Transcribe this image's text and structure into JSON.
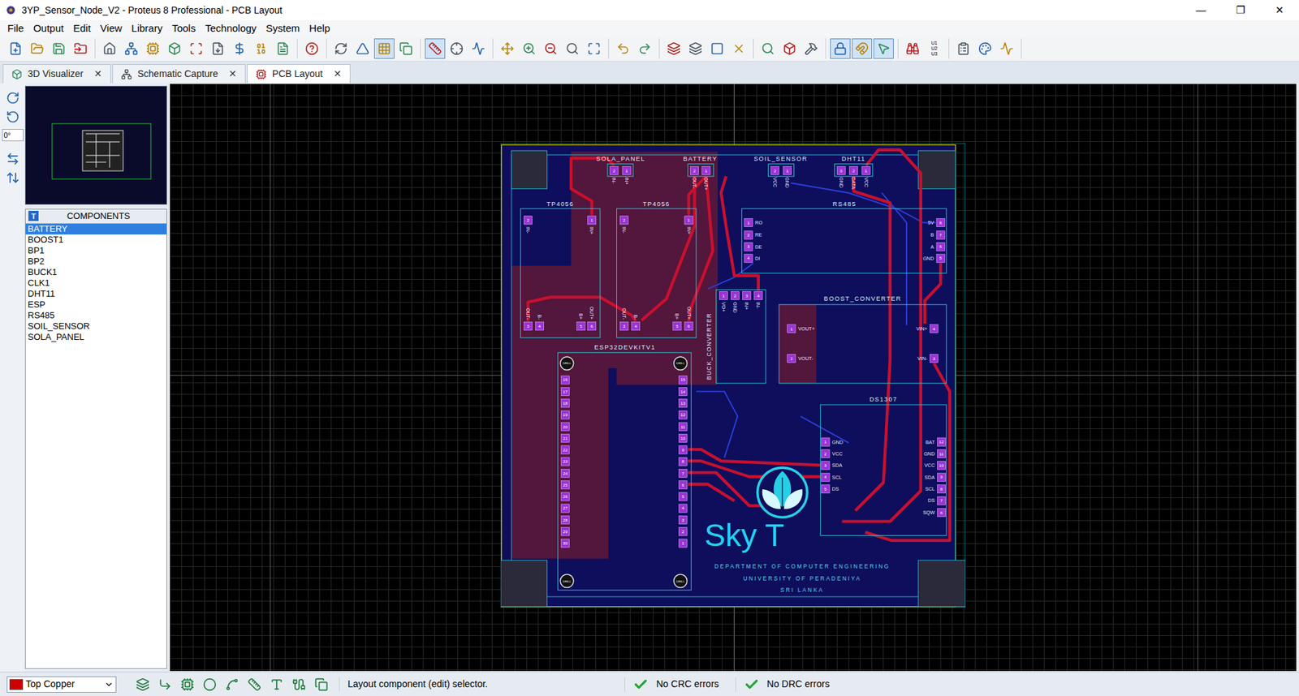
{
  "window": {
    "title": "3YP_Sensor_Node_V2 - Proteus 8 Professional - PCB Layout",
    "controls": [
      "—",
      "❐",
      "✕"
    ]
  },
  "menu": [
    "File",
    "Output",
    "Edit",
    "View",
    "Library",
    "Tools",
    "Technology",
    "System",
    "Help"
  ],
  "toolbar": {
    "groups": [
      [
        {
          "selected": false
        },
        {
          "selected": false
        },
        {
          "selected": false
        },
        {
          "selected": false
        }
      ],
      [
        {
          "selected": false
        },
        {
          "selected": false
        },
        {
          "selected": false
        },
        {
          "selected": false
        },
        {
          "selected": false
        },
        {
          "selected": false
        },
        {
          "selected": false
        },
        {
          "selected": false
        },
        {
          "selected": false
        }
      ],
      [
        {
          "selected": false
        }
      ],
      [
        {
          "selected": false
        },
        {
          "selected": false
        },
        {
          "selected": true
        },
        {
          "selected": false
        }
      ],
      [
        {
          "selected": true
        },
        {
          "selected": false
        },
        {
          "selected": false
        }
      ],
      [
        {
          "selected": false
        },
        {
          "selected": false
        },
        {
          "selected": false
        },
        {
          "selected": false
        },
        {
          "selected": false
        }
      ],
      [
        {
          "selected": false
        },
        {
          "selected": false
        }
      ],
      [
        {
          "selected": false
        },
        {
          "selected": false
        },
        {
          "selected": false
        },
        {
          "selected": false
        }
      ],
      [
        {
          "selected": false
        },
        {
          "selected": false
        },
        {
          "selected": false
        }
      ],
      [
        {
          "selected": true
        },
        {
          "selected": true
        },
        {
          "selected": true
        }
      ],
      [
        {
          "selected": false
        }
      ],
      [
        {
          "selected": false
        },
        {
          "selected": false
        },
        {
          "selected": false
        }
      ]
    ],
    "annotate_button": {
      "lines": [
        "U1",
        "U2",
        "U3"
      ],
      "selected": false
    }
  },
  "tabs": [
    {
      "label": "3D Visualizer",
      "selected": false,
      "close": "✕"
    },
    {
      "label": "Schematic Capture",
      "selected": false,
      "close": "✕"
    },
    {
      "label": "PCB Layout",
      "selected": true,
      "close": "✕"
    }
  ],
  "rotation": {
    "angle": "0°"
  },
  "components_panel": {
    "badge": "T",
    "title": "COMPONENTS",
    "items": [
      {
        "label": "BATTERY",
        "selected": true
      },
      {
        "label": "BOOST1",
        "selected": false
      },
      {
        "label": "BP1",
        "selected": false
      },
      {
        "label": "BP2",
        "selected": false
      },
      {
        "label": "BUCK1",
        "selected": false
      },
      {
        "label": "CLK1",
        "selected": false
      },
      {
        "label": "DHT11",
        "selected": false
      },
      {
        "label": "ESP",
        "selected": false
      },
      {
        "label": "RS485",
        "selected": false
      },
      {
        "label": "SOIL_SENSOR",
        "selected": false
      },
      {
        "label": "SOLA_PANEL",
        "selected": false
      }
    ]
  },
  "pcb": {
    "components": [
      {
        "ref": "SOLA_PANEL",
        "pins": [
          {
            "num": "2",
            "label": "IN-"
          },
          {
            "num": "1",
            "label": "IN+"
          }
        ]
      },
      {
        "ref": "BATTERY",
        "pins": [
          {
            "num": "2",
            "label": "OUT-"
          },
          {
            "num": "1",
            "label": "OUT+"
          }
        ]
      },
      {
        "ref": "SOIL_SENSOR",
        "pins": [
          {
            "num": "2",
            "label": "VCC"
          },
          {
            "num": "1",
            "label": "GND"
          }
        ]
      },
      {
        "ref": "DHT11",
        "pins": [
          {
            "num": "3",
            "label": "GND"
          },
          {
            "num": "2",
            "label": "DATA"
          },
          {
            "num": "1",
            "label": "VCC"
          }
        ]
      },
      {
        "ref": "TP4056",
        "pins": [
          {
            "num": "2",
            "label": "IN-"
          },
          {
            "num": "1",
            "label": "IN+"
          },
          {
            "num": "3",
            "label": "OUT-"
          },
          {
            "num": "4",
            "label": "B-"
          },
          {
            "num": "5",
            "label": "B+"
          },
          {
            "num": "6",
            "label": "OUT+"
          }
        ]
      },
      {
        "ref": "TP4056",
        "pins": [
          {
            "num": "2",
            "label": "IN-"
          },
          {
            "num": "1",
            "label": "IN+"
          },
          {
            "num": "3",
            "label": "OUT-"
          },
          {
            "num": "4",
            "label": "B-"
          },
          {
            "num": "5",
            "label": "B+"
          },
          {
            "num": "6",
            "label": "OUT+"
          }
        ]
      },
      {
        "ref": "RS485",
        "pins": [
          {
            "num": "1",
            "label": "RO"
          },
          {
            "num": "2",
            "label": "RE"
          },
          {
            "num": "3",
            "label": "DE"
          },
          {
            "num": "4",
            "label": "DI"
          },
          {
            "num": "8",
            "label": "5V"
          },
          {
            "num": "7",
            "label": "B"
          },
          {
            "num": "6",
            "label": "A"
          },
          {
            "num": "5",
            "label": "GND"
          }
        ]
      },
      {
        "ref": "BUCK_CONVERTER",
        "pins": [
          {
            "num": "1",
            "label": "VO+"
          },
          {
            "num": "2",
            "label": "GND"
          },
          {
            "num": "3",
            "label": "IN+"
          },
          {
            "num": "4",
            "label": "IN-"
          }
        ]
      },
      {
        "ref": "BOOST_CONVERTER",
        "pins": [
          {
            "num": "1",
            "label": "VOUT+"
          },
          {
            "num": "2",
            "label": "VOUT-"
          },
          {
            "num": "4",
            "label": "VIN+"
          },
          {
            "num": "3",
            "label": "VIN-"
          }
        ]
      },
      {
        "ref": "ESP32DEVKITV1",
        "drills": [
          "DRILL",
          "DRILL",
          "DRILL",
          "DRILL"
        ],
        "pins": [
          {
            "num": "16"
          },
          {
            "num": "17"
          },
          {
            "num": "18"
          },
          {
            "num": "19"
          },
          {
            "num": "20"
          },
          {
            "num": "21"
          },
          {
            "num": "22"
          },
          {
            "num": "23"
          },
          {
            "num": "24"
          },
          {
            "num": "25"
          },
          {
            "num": "26"
          },
          {
            "num": "27"
          },
          {
            "num": "28"
          },
          {
            "num": "29"
          },
          {
            "num": "30"
          },
          {
            "num": "15"
          },
          {
            "num": "14"
          },
          {
            "num": "13"
          },
          {
            "num": "12"
          },
          {
            "num": "11"
          },
          {
            "num": "10"
          },
          {
            "num": "9"
          },
          {
            "num": "8"
          },
          {
            "num": "7"
          },
          {
            "num": "6"
          },
          {
            "num": "5"
          },
          {
            "num": "4"
          },
          {
            "num": "3"
          },
          {
            "num": "2"
          },
          {
            "num": "1"
          }
        ]
      },
      {
        "ref": "DS1307",
        "pins": [
          {
            "num": "1",
            "label": "GND"
          },
          {
            "num": "2",
            "label": "VCC"
          },
          {
            "num": "3",
            "label": "SDA"
          },
          {
            "num": "4",
            "label": "SCL"
          },
          {
            "num": "5",
            "label": "DS"
          },
          {
            "num": "12",
            "label": "BAT"
          },
          {
            "num": "11",
            "label": "GND"
          },
          {
            "num": "10",
            "label": "VCC"
          },
          {
            "num": "9",
            "label": "SDA"
          },
          {
            "num": "8",
            "label": "SCL"
          },
          {
            "num": "7",
            "label": "DS"
          },
          {
            "num": "6",
            "label": "SQW"
          }
        ]
      }
    ],
    "logo": "Sky T",
    "footer": [
      "DEPARTMENT OF COMPUTER ENGINEERING",
      "UNIVERSITY OF PERADENIYA",
      "SRI LANKA"
    ]
  },
  "status_bar": {
    "layer": {
      "label": "Top Copper",
      "color": "#cc0000"
    },
    "tools": [
      {
        "selected": false
      },
      {
        "selected": false
      },
      {
        "selected": false
      },
      {
        "selected": false
      },
      {
        "selected": false
      },
      {
        "selected": false
      },
      {
        "selected": false
      },
      {
        "selected": false
      },
      {
        "selected": false
      }
    ],
    "message": "Layout component (edit) selector.",
    "checks": [
      {
        "label": "No CRC errors",
        "ok": true
      },
      {
        "label": "No DRC errors",
        "ok": true
      }
    ]
  }
}
